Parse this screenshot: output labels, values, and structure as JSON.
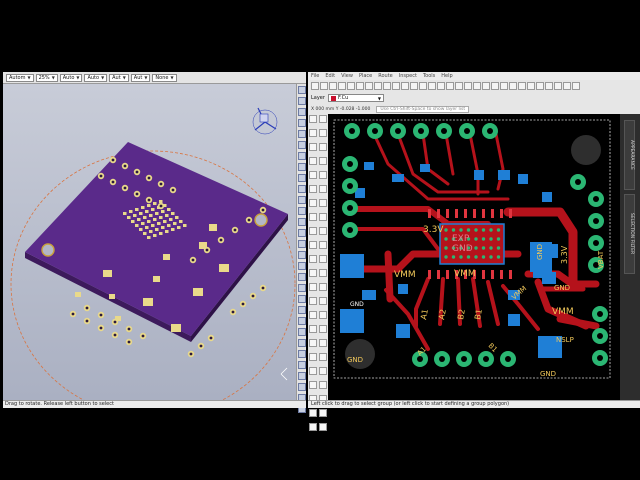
{
  "cad": {
    "toolbar": [
      {
        "value": "Autom",
        "has_dropdown": true
      },
      {
        "value": "25%",
        "has_dropdown": true
      },
      {
        "value": "Auto",
        "has_dropdown": true
      },
      {
        "value": "Auto",
        "has_dropdown": true
      },
      {
        "value": "Aut",
        "has_dropdown": true
      },
      {
        "value": "Aut",
        "has_dropdown": true
      },
      {
        "value": "None",
        "has_dropdown": true
      }
    ],
    "status": "Drag to rotate. Release left button to select"
  },
  "pcb": {
    "menubar": [
      "File",
      "Edit",
      "View",
      "Place",
      "Route",
      "Inspect",
      "Tools",
      "Help"
    ],
    "layer_label": "Layer",
    "layer_value": "F.Cu",
    "layer_color": "#c8102e",
    "coords": "X 000 mm Y -0.028 -1.000",
    "hint": "Use Ctrl-Shift-Space to show layer list",
    "right_tabs": [
      "APPEARANCE",
      "SELECTION FILTER"
    ],
    "status": "Left click to drag to select group (or left click to start defining a group polygon)",
    "board": {
      "labels": {
        "v33_top": "3.3V",
        "v33_right": "3.3V",
        "exp": "EXP",
        "gnd_center": "GND",
        "vmm_left": "VMM",
        "vmm_center": "VMM",
        "vmm_right": "VMM",
        "vbat": "VBAT",
        "gnd_right": "GND",
        "gnd_right2": "GND",
        "gnd_left": "GND",
        "gnd_bottom": "GND",
        "a1": "A1",
        "a2": "A2",
        "b2": "B2",
        "b1": "B1",
        "a1b": "A1",
        "b1b": "B1",
        "vmm_diag": "VMM",
        "nslp": "NSLP",
        "gnd_small": "GND"
      }
    }
  }
}
